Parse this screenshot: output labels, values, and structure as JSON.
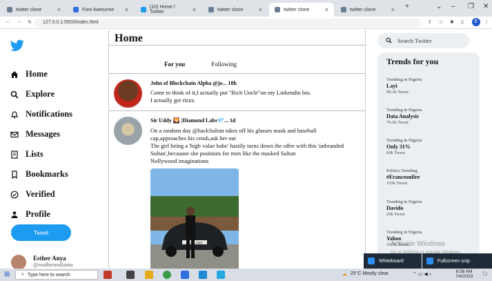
{
  "browser": {
    "tabs": [
      {
        "label": "twitter clone"
      },
      {
        "label": "Font Awesome"
      },
      {
        "label": "(10) Home / Twitter"
      },
      {
        "label": "twitter clone"
      },
      {
        "label": "twitter clone"
      },
      {
        "label": "twitter clone"
      }
    ],
    "url": "127.0.0.1:5500/index.html",
    "profile_initial": "E"
  },
  "sidebar": {
    "items": [
      {
        "label": "Home",
        "icon": "home-icon"
      },
      {
        "label": "Explore",
        "icon": "search-icon"
      },
      {
        "label": "Notifications",
        "icon": "bell-icon"
      },
      {
        "label": "Messages",
        "icon": "envelope-icon"
      },
      {
        "label": "Lists",
        "icon": "list-icon"
      },
      {
        "label": "Bookmarks",
        "icon": "bookmark-icon"
      },
      {
        "label": "Verified",
        "icon": "check-circle-icon"
      },
      {
        "label": "Profile",
        "icon": "user-icon"
      }
    ],
    "tweet_button": "Tweet",
    "user": {
      "name": "Esther Anya",
      "handle": "@esatherandiamu"
    }
  },
  "feed": {
    "title": "Home",
    "tabs": [
      "For you",
      "Following"
    ],
    "posts": [
      {
        "author": "John of Blockchain Alpha @jo... 18h",
        "text": [
          "Come to think of it,I actually put \"Rich Uncle\"on my Linkendin bio.",
          "I actually get rizzz."
        ]
      },
      {
        "author": "Sir Uddy 🌄 |Diamond Labs💎... 1d",
        "text": [
          "On a random day @hackSultan takes off his glasses mask and baseball",
          "cap,approaches his crush,ask her out",
          "The girl being a 'high value babe' hastily turns down the offer with this 'unbranded",
          "Sultan',becauase she positions for men like the masked Sultan",
          "Nollywood imaginations"
        ],
        "plate": "SAPE PMP"
      }
    ]
  },
  "right": {
    "search_placeholder": "Search Twitter",
    "trends_title": "Trends for you",
    "trends": [
      {
        "category": "Trending in Nigeria",
        "name": "Layi",
        "count": "90.3k Tweet"
      },
      {
        "category": "Trending in Nigeria",
        "name": "Data Analysis",
        "count": "70.5k Tweet"
      },
      {
        "category": "Trending in Nigeria",
        "name": "Only 31%",
        "count": "60k Tweet"
      },
      {
        "category": "Politics Trending",
        "name": "#Franceonfire",
        "count": "103k Tweet"
      },
      {
        "category": "Trending in Nigeria",
        "name": "Davido",
        "count": "20k Tweet"
      },
      {
        "category": "Trending in Nigeria",
        "name": "Yahoo",
        "count": "10.5k Tweet"
      }
    ]
  },
  "os": {
    "activate_title": "Activate Windows",
    "activate_sub": "Go to Settings to activate Windows.",
    "toasts": [
      "Whiteboard",
      "Fullscreen snip"
    ],
    "taskbar_search": "Type here to search",
    "weather": "25°C  Mostly clear",
    "time": "6:58 AM",
    "date": "7/4/2023"
  }
}
